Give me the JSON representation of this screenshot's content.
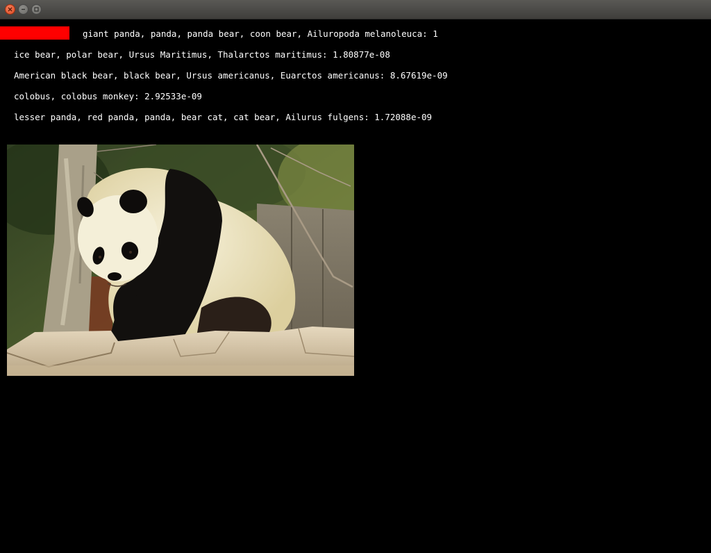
{
  "window": {
    "buttons": [
      "close",
      "minimize",
      "maximize"
    ]
  },
  "predictions": [
    {
      "label": "giant panda, panda, panda bear, coon bear, Ailuropoda melanoleuca",
      "score": "1",
      "text": "giant panda, panda, panda bear, coon bear, Ailuropoda melanoleuca: 1"
    },
    {
      "label": "ice bear, polar bear, Ursus Maritimus, Thalarctos maritimus",
      "score": "1.80877e-08",
      "text": "ice bear, polar bear, Ursus Maritimus, Thalarctos maritimus: 1.80877e-08"
    },
    {
      "label": "American black bear, black bear, Ursus americanus, Euarctos americanus",
      "score": "8.67619e-09",
      "text": "American black bear, black bear, Ursus americanus, Euarctos americanus: 8.67619e-09"
    },
    {
      "label": "colobus, colobus monkey",
      "score": "2.92533e-09",
      "text": "colobus, colobus monkey: 2.92533e-09"
    },
    {
      "label": "lesser panda, red panda, panda, bear cat, cat bear, Ailurus fulgens",
      "score": "1.72088e-09",
      "text": "lesser panda, red panda, panda, bear cat, cat bear, Ailurus fulgens: 1.72088e-09"
    }
  ],
  "top_score_fraction": 1.0,
  "colors": {
    "score_bar": "#ff0000",
    "background": "#000000",
    "text": "#ffffff"
  }
}
